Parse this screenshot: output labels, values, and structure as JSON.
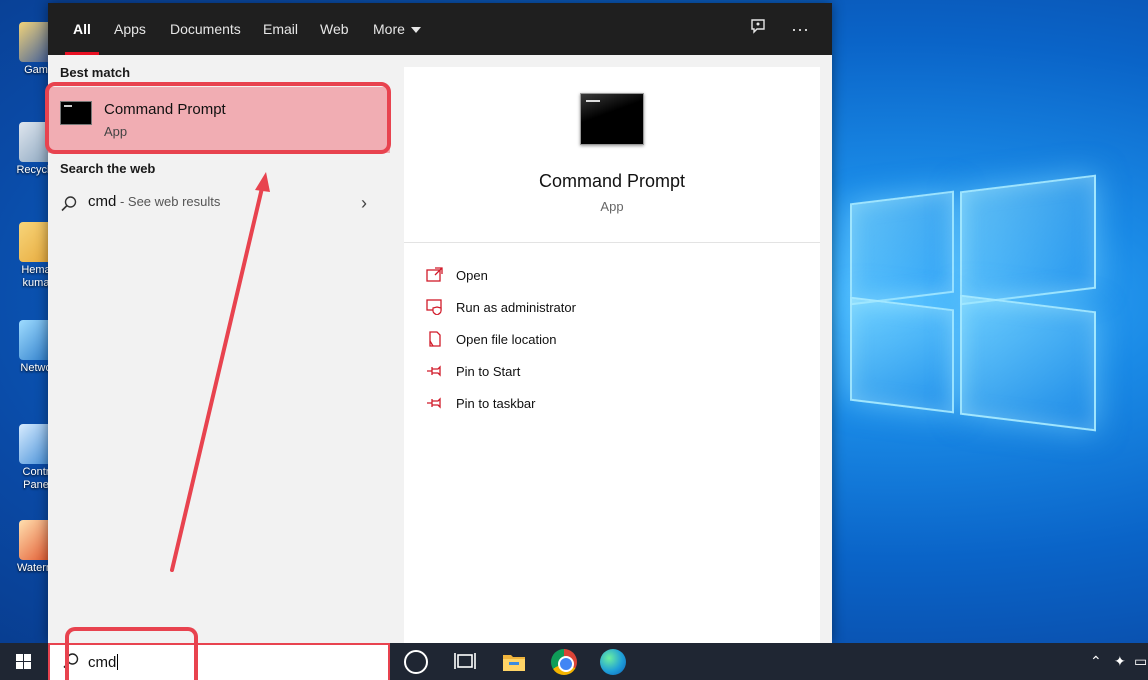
{
  "desktop": {
    "icons": [
      {
        "label": "Gam"
      },
      {
        "label": "Recycle"
      },
      {
        "label": "Hema\nkuma"
      },
      {
        "label": "Netwo"
      },
      {
        "label": "Contr\nPane"
      },
      {
        "label": "Waterm"
      }
    ]
  },
  "search": {
    "tabs": [
      {
        "label": "All"
      },
      {
        "label": "Apps"
      },
      {
        "label": "Documents"
      },
      {
        "label": "Email"
      },
      {
        "label": "Web"
      },
      {
        "label": "More"
      }
    ],
    "best_match_header": "Best match",
    "best_match": {
      "title": "Command Prompt",
      "subtitle": "App"
    },
    "search_web_header": "Search the web",
    "web_result": {
      "query": "cmd",
      "hint": " - See web results"
    }
  },
  "detail": {
    "title": "Command Prompt",
    "subtitle": "App",
    "actions": [
      {
        "label": "Open",
        "icon": "open-icon"
      },
      {
        "label": "Run as administrator",
        "icon": "shield-admin-icon"
      },
      {
        "label": "Open file location",
        "icon": "file-location-icon"
      },
      {
        "label": "Pin to Start",
        "icon": "pin-icon"
      },
      {
        "label": "Pin to taskbar",
        "icon": "pin-icon"
      }
    ]
  },
  "taskbar": {
    "search_value": "cmd"
  },
  "colors": {
    "highlight": "#e8434f",
    "selected_bg": "#f1adb3",
    "accent_red": "#e81123"
  }
}
